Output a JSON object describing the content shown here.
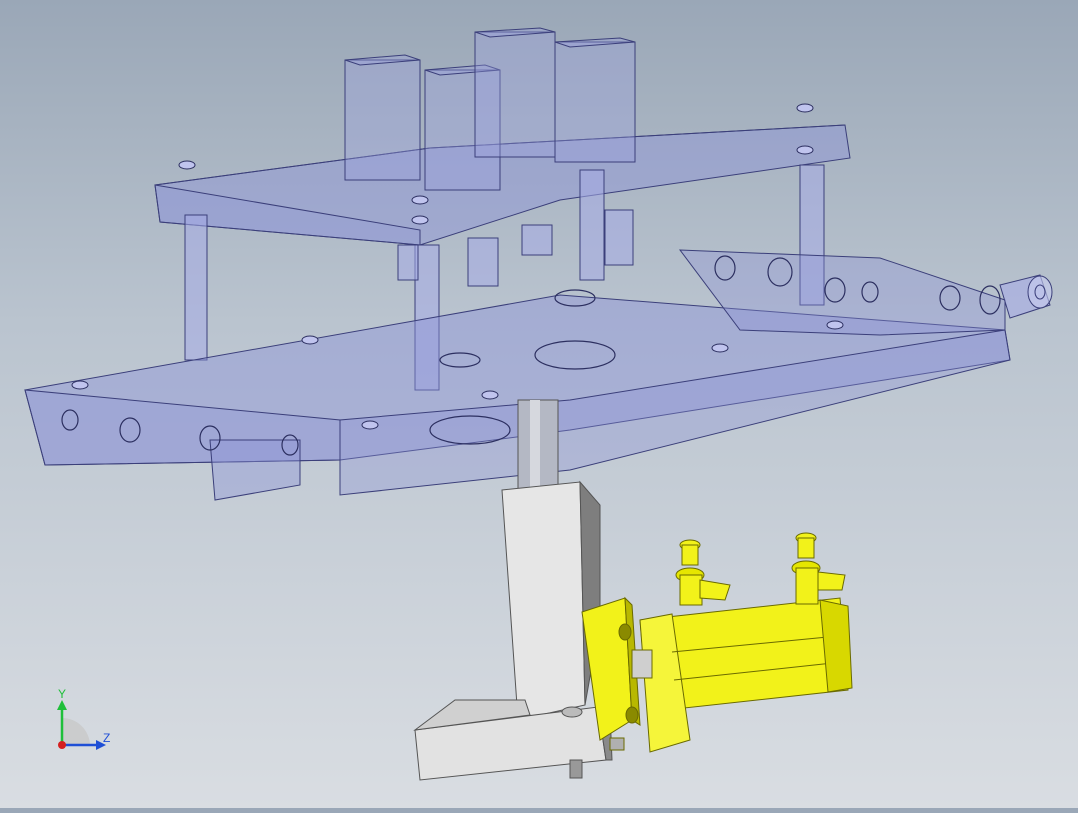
{
  "viewport": {
    "background_top": "#9aa7b7",
    "background_bottom": "#d9dde2"
  },
  "model": {
    "plate_color": "#8c93d8",
    "plate_edge_color": "#3b3f7a",
    "cylinder_color": "#f2f21a",
    "bracket_color": "#e6e6e6"
  },
  "triad": {
    "y_label": "Y",
    "z_label": "Z",
    "y_color": "#1fbf3a",
    "z_color": "#1f4fd6",
    "x_color": "#d42020"
  }
}
